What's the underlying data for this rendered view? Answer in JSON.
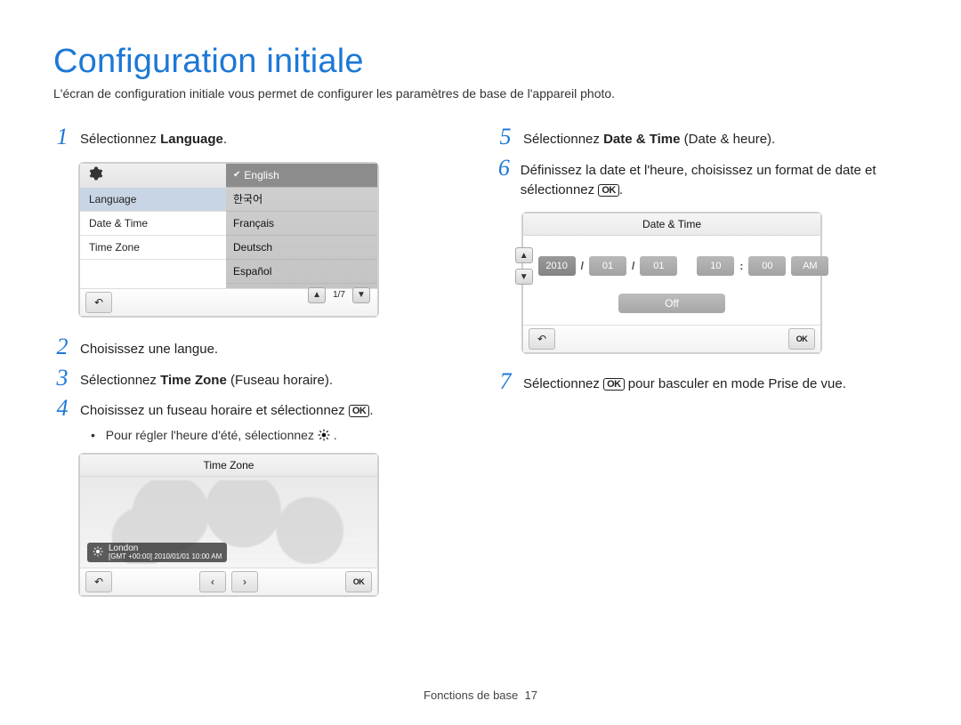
{
  "page": {
    "title": "Configuration initiale",
    "subtitle": "L'écran de configuration initiale vous permet de configurer les paramètres de base de l'appareil photo.",
    "footer_label": "Fonctions de base",
    "footer_page": "17"
  },
  "steps": {
    "s1_prefix": "Sélectionnez ",
    "s1_bold": "Language",
    "s1_suffix": ".",
    "s2": "Choisissez une langue.",
    "s3_prefix": "Sélectionnez ",
    "s3_bold": "Time Zone",
    "s3_suffix": " (Fuseau horaire).",
    "s4_prefix": "Choisissez un fuseau horaire et sélectionnez ",
    "s4_ok": "OK",
    "s4_suffix": ".",
    "s4_bullet": "Pour régler l'heure d'été, sélectionnez ",
    "s5_prefix": "Sélectionnez ",
    "s5_bold": "Date & Time",
    "s5_suffix": " (Date & heure).",
    "s6_prefix": "Définissez la date et l'heure, choisissez un format de date et sélectionnez ",
    "s6_ok": "OK",
    "s6_suffix": ".",
    "s7_prefix": "Sélectionnez ",
    "s7_ok": "OK",
    "s7_suffix": " pour basculer en mode Prise de vue."
  },
  "lang_panel": {
    "left": [
      "Language",
      "Date & Time",
      "Time Zone"
    ],
    "options": [
      "English",
      "한국어",
      "Français",
      "Deutsch",
      "Español"
    ],
    "pager": "1/7"
  },
  "tz_panel": {
    "title": "Time Zone",
    "city": "London",
    "info": "[GMT +00:00] 2010/01/01 10:00 AM"
  },
  "dt_panel": {
    "title": "Date & Time",
    "year": "2010",
    "m": "01",
    "d": "01",
    "hh": "10",
    "mm": "00",
    "ampm": "AM",
    "off": "Off"
  },
  "glyph": {
    "back": "↶",
    "up": "▲",
    "down": "▼",
    "left": "‹",
    "right": "›",
    "ok": "OK"
  }
}
